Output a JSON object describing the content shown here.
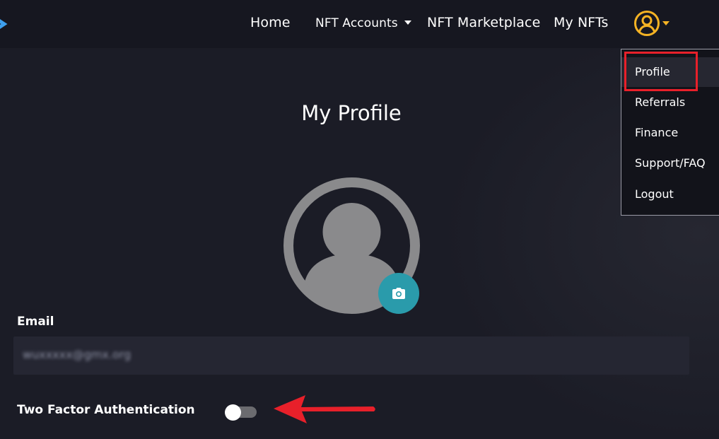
{
  "navbar": {
    "links": {
      "home": "Home",
      "nft_accounts": "NFT Accounts",
      "nft_marketplace": "NFT Marketplace",
      "my_nfts": "My NFTs"
    },
    "user_icon": "user-circle-icon",
    "user_icon_color": "#f5b324"
  },
  "user_menu": {
    "items": [
      "Profile",
      "Referrals",
      "Finance",
      "Support/FAQ",
      "Logout"
    ],
    "active_item": "Profile"
  },
  "profile": {
    "title": "My Profile",
    "avatar_icon": "avatar-placeholder-icon",
    "camera_icon": "camera-icon",
    "email_label": "Email",
    "email_value": "wuxxxxx@gmx.org",
    "two_factor_label": "Two Factor Authentication",
    "two_factor_enabled": false
  },
  "annotations": {
    "highlight_color": "#e8202a",
    "arrow_color": "#e8202a"
  },
  "colors": {
    "background": "#1b1c26",
    "navbar": "#161720",
    "accent_teal": "#2a9bab"
  }
}
